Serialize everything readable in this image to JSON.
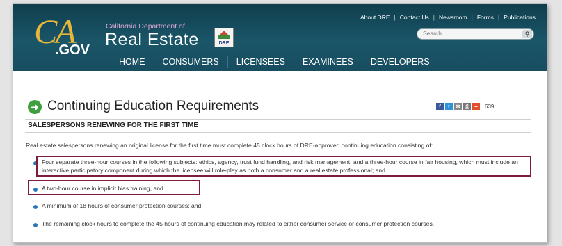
{
  "header": {
    "logo_ca": "CA",
    "logo_gov": ".GOV",
    "dept_small": "California Department of",
    "dept_big": "Real Estate",
    "dre_badge": "DRE",
    "top_links": [
      "About DRE",
      "Contact Us",
      "Newsroom",
      "Forms",
      "Publications"
    ],
    "search_placeholder": "Search",
    "nav": [
      "HOME",
      "CONSUMERS",
      "LICENSEES",
      "EXAMINEES",
      "DEVELOPERS"
    ]
  },
  "page": {
    "title": "Continuing Education Requirements",
    "share_count": "639",
    "social_icons": [
      "facebook-icon",
      "twitter-icon",
      "email-icon",
      "print-icon",
      "plus-icon"
    ],
    "subheading": "SALESPERSONS RENEWING FOR THE FIRST TIME",
    "intro": "Real estate salespersons renewing an original license for the first time must complete 45 clock hours of DRE-approved continuing education consisting of:",
    "items": [
      "Four separate three-hour courses in the following subjects: ethics, agency, trust fund handling, and risk management, and a three-hour course in fair housing, which must include an interactive participatory component during which the licensee will role-play as both a consumer and a real estate professional; and",
      "A two-hour course in implicit bias training, and",
      "A minimum of 18 hours of consumer protection courses; and",
      "The remaining clock hours to complete the 45 hours of continuing education may related to either consumer service or consumer protection courses."
    ]
  },
  "colors": {
    "header_bg": "#1a5568",
    "highlight_border": "#7d1d3a",
    "bullet": "#2e76b2",
    "logo_gold": "#e7b73a"
  }
}
